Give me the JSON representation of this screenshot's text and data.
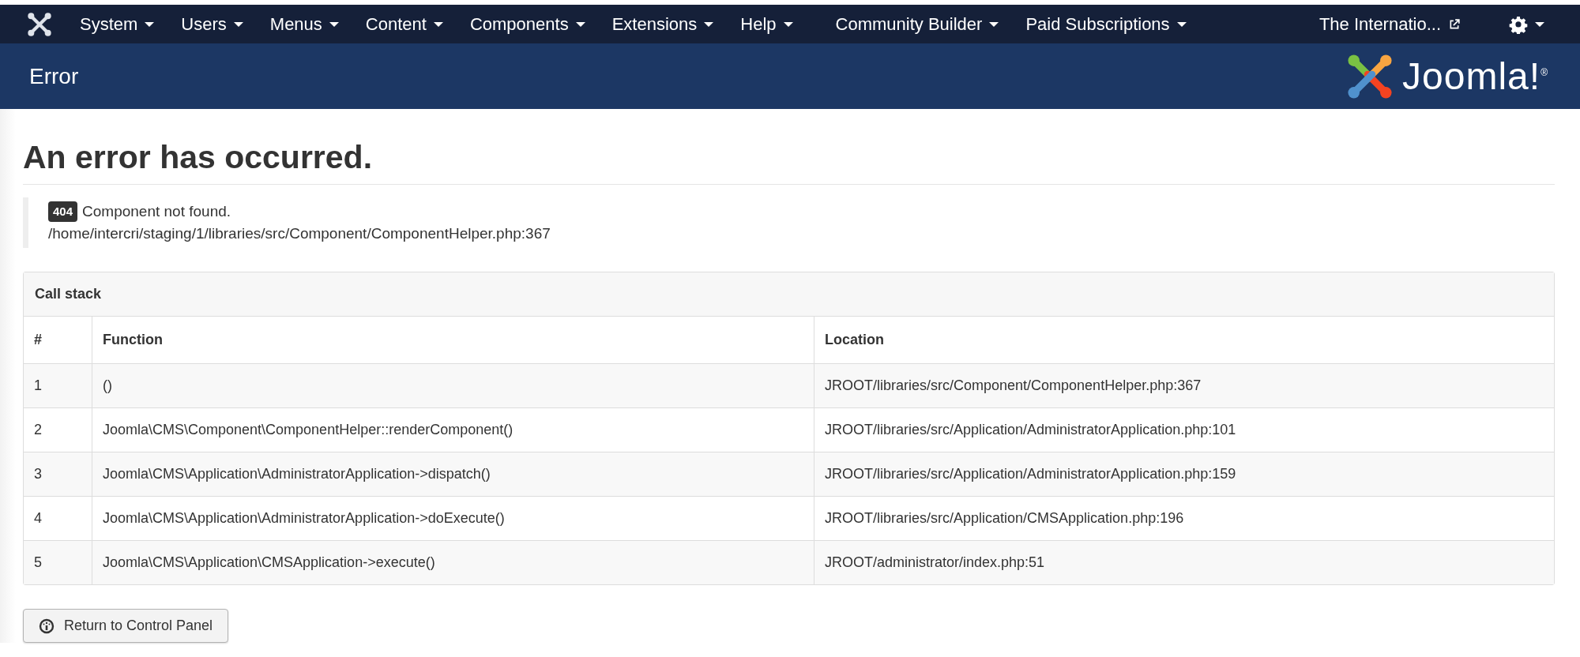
{
  "navbar": {
    "menus": [
      {
        "label": "System"
      },
      {
        "label": "Users"
      },
      {
        "label": "Menus"
      },
      {
        "label": "Content"
      },
      {
        "label": "Components"
      },
      {
        "label": "Extensions"
      },
      {
        "label": "Help"
      },
      {
        "label": "Community Builder"
      },
      {
        "label": "Paid Subscriptions"
      }
    ],
    "site_link": "The Internatio..."
  },
  "header": {
    "title": "Error",
    "brand": "Joomla!$^{®}$"
  },
  "heading": "An error has occurred.",
  "error": {
    "code": "404",
    "message": "Component not found.",
    "path": "/home/intercri/staging/1/libraries/src/Component/ComponentHelper.php:367"
  },
  "call_stack": {
    "title": "Call stack",
    "columns": [
      "#",
      "Function",
      "Location"
    ],
    "rows": [
      {
        "number": "1",
        "function": "()",
        "location": "JROOT/libraries/src/Component/ComponentHelper.php:367"
      },
      {
        "number": "2",
        "function": "Joomla\\CMS\\Component\\ComponentHelper::renderComponent()",
        "location": "JROOT/libraries/src/Application/AdministratorApplication.php:101"
      },
      {
        "number": "3",
        "function": "Joomla\\CMS\\Application\\AdministratorApplication->dispatch()",
        "location": "JROOT/libraries/src/Application/AdministratorApplication.php:159"
      },
      {
        "number": "4",
        "function": "Joomla\\CMS\\Application\\AdministratorApplication->doExecute()",
        "location": "JROOT/libraries/src/Application/CMSApplication.php:196"
      },
      {
        "number": "5",
        "function": "Joomla\\CMS\\Application\\CMSApplication->execute()",
        "location": "JROOT/administrator/index.php:51"
      }
    ]
  },
  "return_button": "Return to Control Panel"
}
